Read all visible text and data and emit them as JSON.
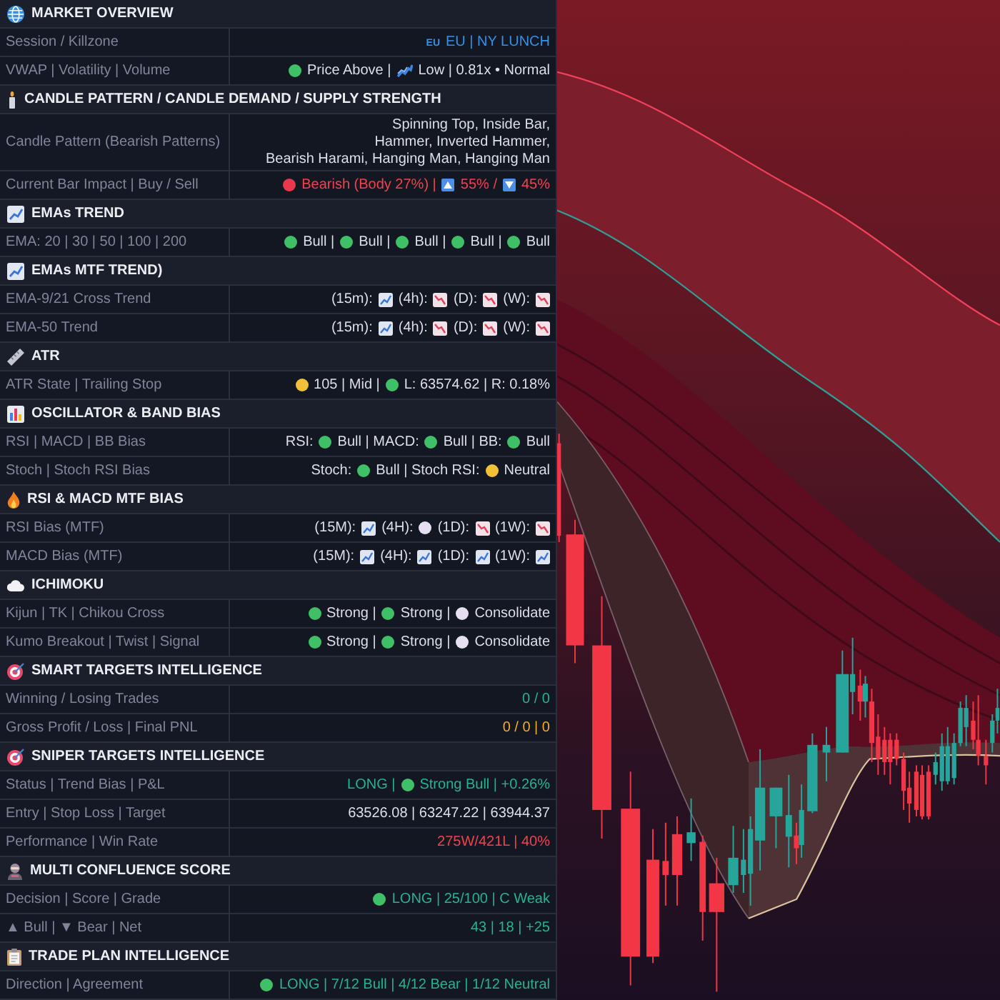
{
  "sections": [
    {
      "title": "MARKET OVERVIEW",
      "rows": [
        {
          "label": "Session / Killzone",
          "color": "#3291ea",
          "value": [
            {
              "kind": "flag",
              "text": "EU"
            },
            {
              "kind": "text",
              "text": "EU | NY LUNCH"
            }
          ]
        },
        {
          "label": "VWAP | Volatility | Volume",
          "value": [
            {
              "kind": "dot",
              "color": "#3fbf66"
            },
            {
              "kind": "text",
              "text": "Price Above |"
            },
            {
              "kind": "wave"
            },
            {
              "kind": "text",
              "text": "Low | 0.81x • Normal"
            }
          ]
        }
      ]
    },
    {
      "title": "CANDLE PATTERN / CANDLE DEMAND / SUPPLY STRENGTH",
      "rows": [
        {
          "label": "Candle Pattern (Bearish Patterns)",
          "lines": [
            "Spinning Top, Inside Bar,",
            "Hammer, Inverted Hammer,",
            "Bearish Harami, Hanging Man, Hanging Man"
          ]
        },
        {
          "label": "Current Bar Impact | Buy / Sell",
          "color": "#f0424f",
          "value": [
            {
              "kind": "dot",
              "color": "#e8394c"
            },
            {
              "kind": "text",
              "text": "Bearish (Body 27%) |"
            },
            {
              "kind": "arrow",
              "up": true
            },
            {
              "kind": "text",
              "text": "55% /"
            },
            {
              "kind": "arrow",
              "up": false
            },
            {
              "kind": "text",
              "text": "45%"
            }
          ]
        }
      ]
    },
    {
      "title": "EMAs TREND",
      "rows": [
        {
          "label": "EMA: 20 | 30 | 50 | 100 | 200",
          "value": [
            {
              "kind": "dot",
              "color": "#3fbf66"
            },
            {
              "kind": "text",
              "text": "Bull |"
            },
            {
              "kind": "dot",
              "color": "#3fbf66"
            },
            {
              "kind": "text",
              "text": "Bull |"
            },
            {
              "kind": "dot",
              "color": "#3fbf66"
            },
            {
              "kind": "text",
              "text": "Bull |"
            },
            {
              "kind": "dot",
              "color": "#3fbf66"
            },
            {
              "kind": "text",
              "text": "Bull |"
            },
            {
              "kind": "dot",
              "color": "#3fbf66"
            },
            {
              "kind": "text",
              "text": "Bull"
            }
          ]
        }
      ]
    },
    {
      "title": "EMAs MTF TREND)",
      "rows": [
        {
          "label": "EMA-9/21 Cross Trend",
          "value": [
            {
              "kind": "text",
              "text": "(15m):"
            },
            {
              "kind": "trend",
              "up": true
            },
            {
              "kind": "text",
              "text": "(4h):"
            },
            {
              "kind": "trend",
              "up": false
            },
            {
              "kind": "text",
              "text": "(D):"
            },
            {
              "kind": "trend",
              "up": false
            },
            {
              "kind": "text",
              "text": "(W):"
            },
            {
              "kind": "trend",
              "up": false
            }
          ]
        },
        {
          "label": "EMA-50 Trend",
          "value": [
            {
              "kind": "text",
              "text": "(15m):"
            },
            {
              "kind": "trend",
              "up": true
            },
            {
              "kind": "text",
              "text": "(4h):"
            },
            {
              "kind": "trend",
              "up": false
            },
            {
              "kind": "text",
              "text": "(D):"
            },
            {
              "kind": "trend",
              "up": false
            },
            {
              "kind": "text",
              "text": "(W):"
            },
            {
              "kind": "trend",
              "up": false
            }
          ]
        }
      ]
    },
    {
      "title": "ATR",
      "rows": [
        {
          "label": "ATR State | Trailing Stop",
          "value": [
            {
              "kind": "dot",
              "color": "#f2c037"
            },
            {
              "kind": "text",
              "text": "105 | Mid |"
            },
            {
              "kind": "dot",
              "color": "#3fbf66"
            },
            {
              "kind": "text",
              "text": "L: 63574.62 | R: 0.18%"
            }
          ]
        }
      ]
    },
    {
      "title": "OSCILLATOR & BAND BIAS",
      "rows": [
        {
          "label": "RSI | MACD | BB Bias",
          "value": [
            {
              "kind": "text",
              "text": "RSI:"
            },
            {
              "kind": "dot",
              "color": "#3fbf66"
            },
            {
              "kind": "text",
              "text": "Bull | MACD:"
            },
            {
              "kind": "dot",
              "color": "#3fbf66"
            },
            {
              "kind": "text",
              "text": "Bull | BB:"
            },
            {
              "kind": "dot",
              "color": "#3fbf66"
            },
            {
              "kind": "text",
              "text": "Bull"
            }
          ]
        },
        {
          "label": "Stoch | Stoch RSI Bias",
          "value": [
            {
              "kind": "text",
              "text": "Stoch:"
            },
            {
              "kind": "dot",
              "color": "#3fbf66"
            },
            {
              "kind": "text",
              "text": "Bull | Stoch RSI:"
            },
            {
              "kind": "dot",
              "color": "#f2c037"
            },
            {
              "kind": "text",
              "text": "Neutral"
            }
          ]
        }
      ]
    },
    {
      "title": "RSI & MACD MTF BIAS",
      "rows": [
        {
          "label": "RSI Bias (MTF)",
          "value": [
            {
              "kind": "text",
              "text": "(15M):"
            },
            {
              "kind": "trend",
              "up": true
            },
            {
              "kind": "text",
              "text": "(4H):"
            },
            {
              "kind": "dot",
              "color": "#e6dff2"
            },
            {
              "kind": "text",
              "text": "(1D):"
            },
            {
              "kind": "trend",
              "up": false
            },
            {
              "kind": "text",
              "text": "(1W):"
            },
            {
              "kind": "trend",
              "up": false
            }
          ]
        },
        {
          "label": "MACD Bias (MTF)",
          "value": [
            {
              "kind": "text",
              "text": "(15M):"
            },
            {
              "kind": "trend",
              "up": true
            },
            {
              "kind": "text",
              "text": "(4H):"
            },
            {
              "kind": "trend",
              "up": true
            },
            {
              "kind": "text",
              "text": "(1D):"
            },
            {
              "kind": "trend",
              "up": true
            },
            {
              "kind": "text",
              "text": "(1W):"
            },
            {
              "kind": "trend",
              "up": true
            }
          ]
        }
      ]
    },
    {
      "title": "ICHIMOKU",
      "rows": [
        {
          "label": "Kijun | TK | Chikou Cross",
          "value": [
            {
              "kind": "dot",
              "color": "#3fbf66"
            },
            {
              "kind": "text",
              "text": "Strong |"
            },
            {
              "kind": "dot",
              "color": "#3fbf66"
            },
            {
              "kind": "text",
              "text": "Strong |"
            },
            {
              "kind": "dot",
              "color": "#e6dff2"
            },
            {
              "kind": "text",
              "text": "Consolidate"
            }
          ]
        },
        {
          "label": "Kumo Breakout | Twist | Signal",
          "value": [
            {
              "kind": "dot",
              "color": "#3fbf66"
            },
            {
              "kind": "text",
              "text": "Strong |"
            },
            {
              "kind": "dot",
              "color": "#3fbf66"
            },
            {
              "kind": "text",
              "text": "Strong |"
            },
            {
              "kind": "dot",
              "color": "#e6dff2"
            },
            {
              "kind": "text",
              "text": "Consolidate"
            }
          ]
        }
      ]
    },
    {
      "title": "SMART TARGETS INTELLIGENCE",
      "rows": [
        {
          "label": "Winning / Losing Trades",
          "color": "#27b294",
          "value": [
            {
              "kind": "text",
              "text": "0 / 0"
            }
          ]
        },
        {
          "label": "Gross Profit / Loss | Final PNL",
          "color": "#f2ad2f",
          "value": [
            {
              "kind": "text",
              "text": "0 / 0 | 0"
            }
          ]
        }
      ]
    },
    {
      "title": "SNIPER TARGETS INTELLIGENCE",
      "rows": [
        {
          "label": "Status | Trend Bias | P&L",
          "color": "#27b294",
          "value": [
            {
              "kind": "text",
              "text": "LONG |"
            },
            {
              "kind": "dot",
              "color": "#3fbf66"
            },
            {
              "kind": "text",
              "text": "Strong Bull | +0.26%"
            }
          ]
        },
        {
          "label": "Entry | Stop Loss | Target",
          "value": [
            {
              "kind": "text",
              "text": "63526.08 | 63247.22 | 63944.37"
            }
          ]
        },
        {
          "label": "Performance | Win Rate",
          "color": "#f0424f",
          "value": [
            {
              "kind": "text",
              "text": "275W/421L | 40%"
            }
          ]
        }
      ]
    },
    {
      "title": "MULTI CONFLUENCE SCORE",
      "rows": [
        {
          "label": "Decision | Score | Grade",
          "color": "#27b294",
          "value": [
            {
              "kind": "dot",
              "color": "#3fbf66"
            },
            {
              "kind": "text",
              "text": "LONG | 25/100 | C Weak"
            }
          ]
        },
        {
          "label": "▲ Bull | ▼ Bear | Net",
          "color": "#27b294",
          "value": [
            {
              "kind": "text",
              "text": "43 | 18 | +25"
            }
          ]
        }
      ]
    },
    {
      "title": "TRADE PLAN INTELLIGENCE",
      "rows": [
        {
          "label": "Direction | Agreement",
          "color": "#27b294",
          "value": [
            {
              "kind": "dot",
              "color": "#3fbf66"
            },
            {
              "kind": "text",
              "text": "LONG | 7/12 Bull | 4/12 Bear | 1/12 Neutral"
            }
          ]
        }
      ]
    }
  ]
}
